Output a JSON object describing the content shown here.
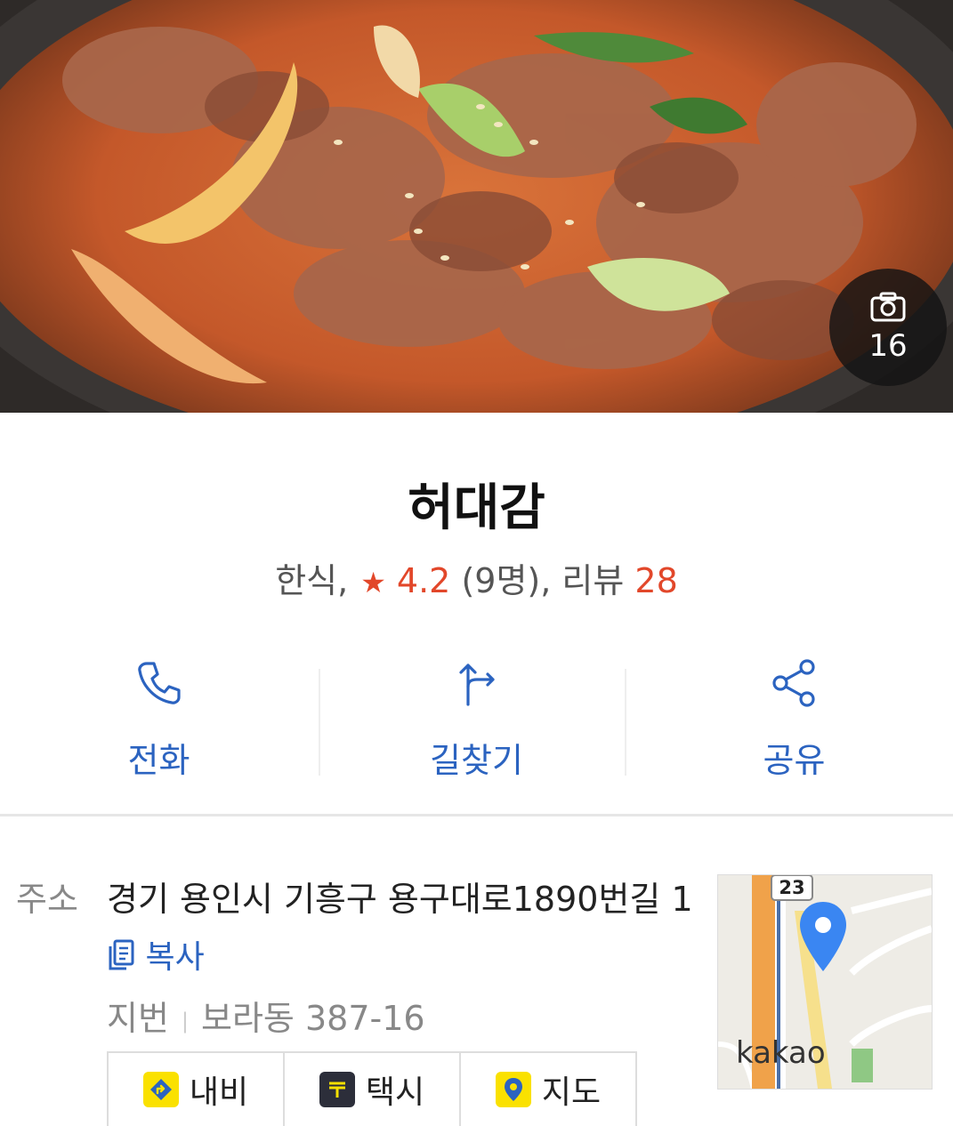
{
  "hero": {
    "photo_count": "16"
  },
  "place": {
    "name": "허대감",
    "category": "한식,",
    "rating": "4.2",
    "rating_count": "(9명),",
    "review_label": "리뷰",
    "review_count": "28"
  },
  "actions": [
    {
      "label": "전화",
      "icon": "phone-icon"
    },
    {
      "label": "길찾기",
      "icon": "directions-icon"
    },
    {
      "label": "공유",
      "icon": "share-icon"
    }
  ],
  "address": {
    "label": "주소",
    "line": "경기 용인시 기흥구 용구대로1890번길 1",
    "copy_label": "복사",
    "jibun_label": "지번",
    "jibun_value": "보라동 387-16"
  },
  "buttons": [
    {
      "label": "내비",
      "icon": "navi-icon"
    },
    {
      "label": "택시",
      "icon": "taxi-icon"
    },
    {
      "label": "지도",
      "icon": "map-pin-icon"
    }
  ],
  "map": {
    "road_number": "23",
    "brand": "kakao"
  },
  "colors": {
    "accent": "#e2472a",
    "link": "#2b63c0",
    "kakao_yellow": "#fae100"
  }
}
